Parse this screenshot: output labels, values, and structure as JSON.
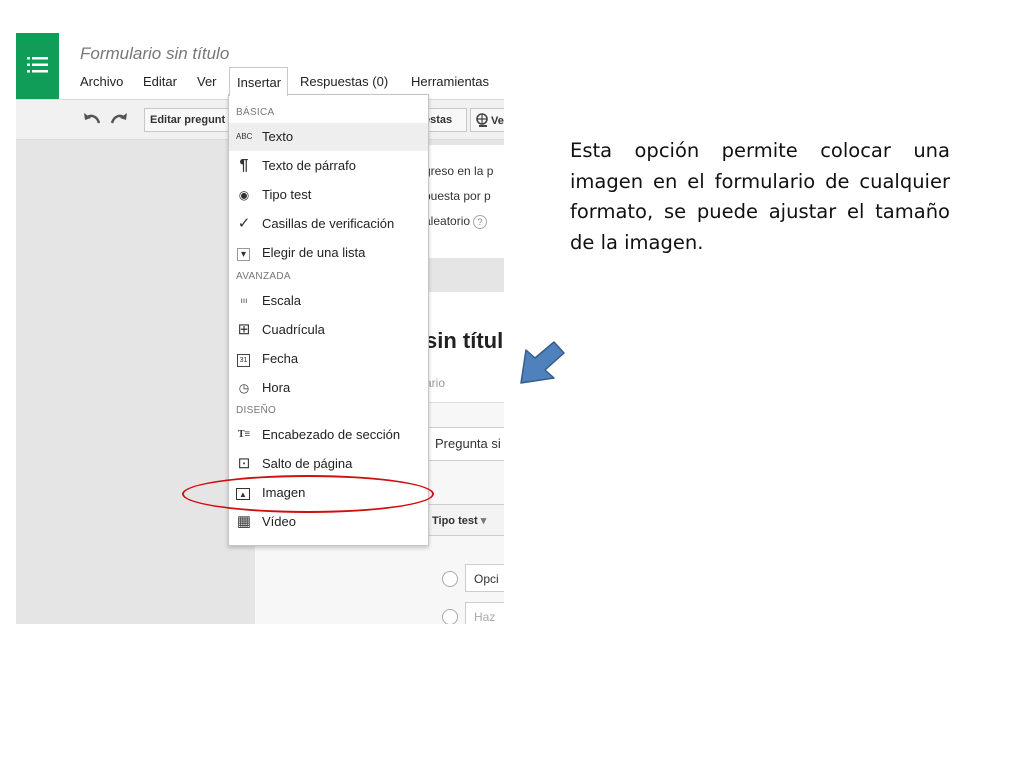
{
  "app": {
    "doc_title": "Formulario sin título",
    "menu": [
      "Archivo",
      "Editar",
      "Ver",
      "Insertar",
      "Respuestas (0)",
      "Herramientas"
    ],
    "toolbar": {
      "edit_question_label": "Editar pregunt",
      "responses_label": "estas",
      "view_label": "Ve"
    }
  },
  "form": {
    "settings_lines": [
      "greso en la p",
      "puesta por p",
      "aleatorio"
    ],
    "help_glyph": "?",
    "title": "sin títul",
    "description": "ario",
    "question_input": "Pregunta si",
    "question_type": "Tipo test",
    "options": [
      "Opci",
      "Haz"
    ]
  },
  "insert_menu": {
    "sections": [
      {
        "title": "BÁSICA",
        "items": [
          {
            "label": "Texto",
            "icon": "text-abc-icon",
            "glyph": "ABC",
            "highlighted": true
          },
          {
            "label": "Texto de párrafo",
            "icon": "paragraph-icon",
            "glyph": "¶"
          },
          {
            "label": "Tipo test",
            "icon": "radio-icon",
            "glyph": "◉"
          },
          {
            "label": "Casillas de verificación",
            "icon": "checkmark-icon",
            "glyph": "✓"
          },
          {
            "label": "Elegir de una lista",
            "icon": "dropdown-list-icon",
            "glyph": "▾"
          }
        ]
      },
      {
        "title": "AVANZADA",
        "items": [
          {
            "label": "Escala",
            "icon": "scale-icon",
            "glyph": "ııı"
          },
          {
            "label": "Cuadrícula",
            "icon": "grid-icon",
            "glyph": "⊞"
          },
          {
            "label": "Fecha",
            "icon": "calendar-icon",
            "glyph": "31"
          },
          {
            "label": "Hora",
            "icon": "clock-icon",
            "glyph": "◷"
          }
        ]
      },
      {
        "title": "DISEÑO",
        "items": [
          {
            "label": "Encabezado de sección",
            "icon": "section-header-icon",
            "glyph": "T≡"
          },
          {
            "label": "Salto de página",
            "icon": "page-break-icon",
            "glyph": "⊡"
          },
          {
            "label": "Imagen",
            "icon": "image-icon",
            "glyph": "▲",
            "circled": true
          },
          {
            "label": "Vídeo",
            "icon": "video-icon",
            "glyph": "▦"
          }
        ]
      }
    ]
  },
  "caption": "Esta opción permite colocar una imagen en el formulario de cualquier formato, se puede ajustar el tamaño de la imagen.",
  "colors": {
    "brand_green": "#0f9d58",
    "highlight_red": "#d01010",
    "arrow_blue": "#4f81bd"
  }
}
